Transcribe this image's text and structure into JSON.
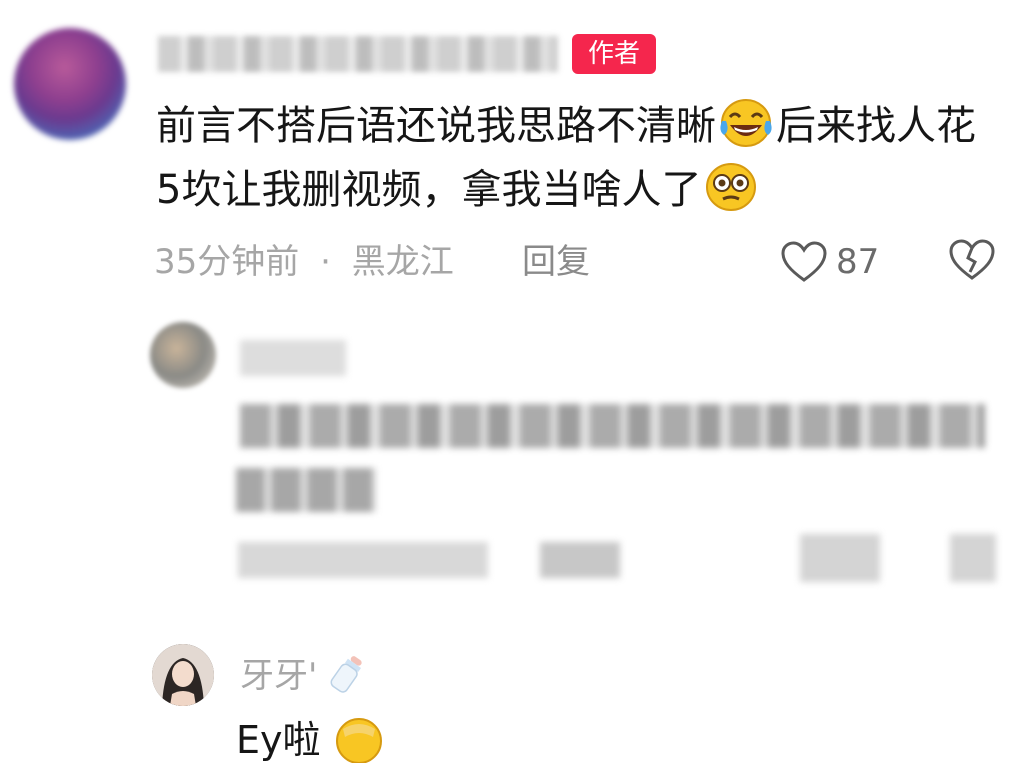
{
  "comment": {
    "badge": "作者",
    "text_part1": "前言不搭后语还说我思路不清晰",
    "text_part2": "后来找人花5坎让我删视频，拿我当啥人了",
    "emoji_1": "laughing-tears-emoji",
    "emoji_2": "dizzy-face-emoji",
    "time": "35分钟前",
    "separator": "·",
    "location": "黑龙江",
    "reply_label": "回复",
    "like_count": "87"
  },
  "reply_third": {
    "username": "牙牙'",
    "username_icon": "baby-bottle-emoji",
    "text": "Ey啦"
  },
  "icons": {
    "like": "heart-outline-icon",
    "dislike": "broken-heart-icon"
  },
  "colors": {
    "badge_bg": "#f5264d",
    "meta_text": "#a6a6a6",
    "body_text": "#161616"
  }
}
